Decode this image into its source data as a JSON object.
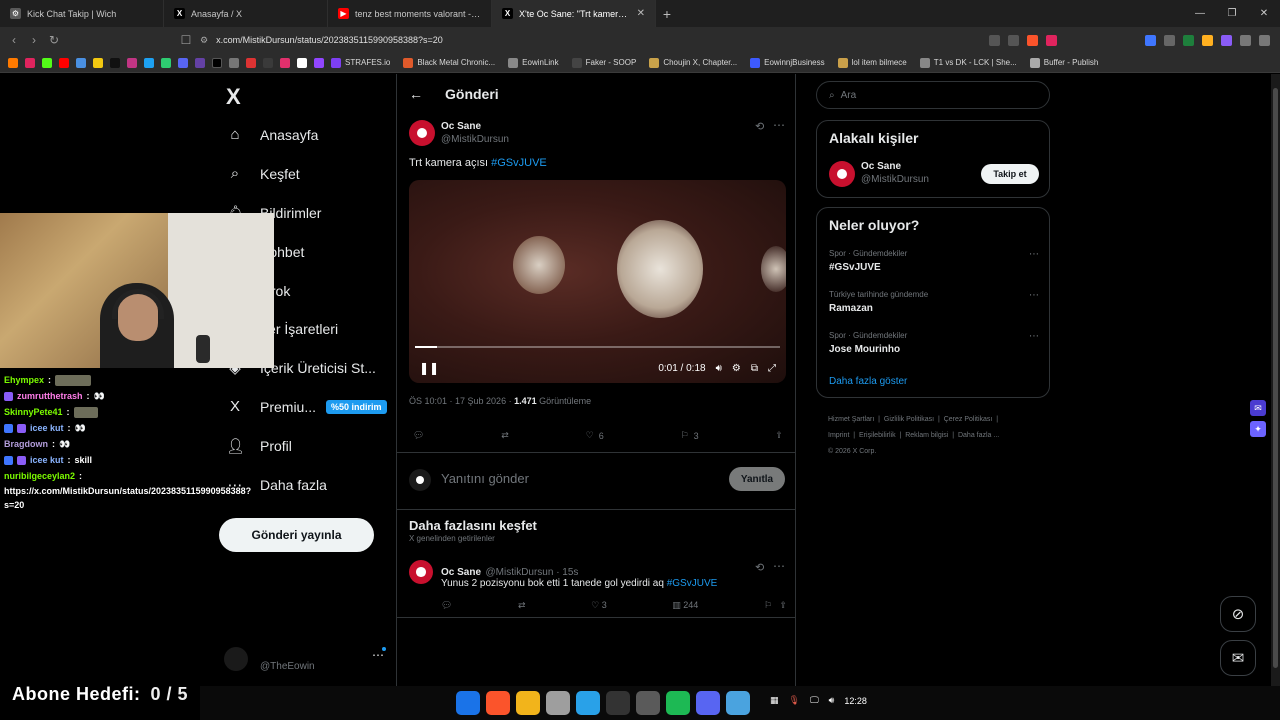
{
  "browser": {
    "tabs": [
      {
        "title": "Kick Chat Takip | Wich",
        "color": "#5a5a5a",
        "glyph": "⚙"
      },
      {
        "title": "Anasayfa / X",
        "color": "#000000",
        "glyph": "X"
      },
      {
        "title": "tenz best moments valorant - YouTub",
        "color": "#ff0000",
        "glyph": "▶"
      },
      {
        "title": "X'te Oc Sane: \"Trt kamera açı",
        "color": "#000000",
        "glyph": "X"
      }
    ],
    "active_tab_index": 3,
    "new_tab": "+",
    "url": "x.com/MistikDursun/status/2023835115990958388?s=20",
    "bookmarks": [
      {
        "label": "STRAFES.io",
        "color": "#7e3ff2"
      },
      {
        "label": "Black Metal Chronic...",
        "color": "#e05a2b"
      },
      {
        "label": "EowinLink",
        "color": "#888888"
      },
      {
        "label": "Faker - SOOP",
        "color": "#444444"
      },
      {
        "label": "Choujin X, Chapter...",
        "color": "#c9a24a"
      },
      {
        "label": "EowinnjBusiness",
        "color": "#3d5afe"
      },
      {
        "label": "lol item bilmece",
        "color": "#caa04a"
      },
      {
        "label": "T1 vs DK - LCK | She...",
        "color": "#888888"
      },
      {
        "label": "Buffer - Publish",
        "color": "#aaaaaa"
      }
    ]
  },
  "sidebar": {
    "logo": "X",
    "items": [
      {
        "label": "Anasayfa",
        "icon": "home-icon"
      },
      {
        "label": "Keşfet",
        "icon": "search-icon"
      },
      {
        "label": "Bildirimler",
        "icon": "bell-icon"
      },
      {
        "label": "Sohbet",
        "icon": "chat-icon"
      },
      {
        "label": "Grok",
        "icon": "grok-icon"
      },
      {
        "label": "Yer İşaretleri",
        "icon": "bookmark-icon"
      },
      {
        "label": "İçerik Üreticisi St...",
        "icon": "creator-icon"
      },
      {
        "label": "Premiu...",
        "icon": "premium-icon"
      },
      {
        "label": "Profil",
        "icon": "profile-icon"
      },
      {
        "label": "Daha fazla",
        "icon": "more-icon"
      }
    ],
    "premium_badge": "%50 indirim",
    "post_button": "Gönderi yayınla",
    "account_handle": "@TheEowin"
  },
  "post": {
    "header_title": "Gönderi",
    "author_name": "Oc Sane",
    "author_handle": "@MistikDursun",
    "text": "Trt kamera açısı ",
    "hashtag": "#GSvJUVE",
    "video_time": "0:01 / 0:18",
    "video_progress": 0.06,
    "timestamp": "ÖS 10:01 · 17 Şub 2026 · ",
    "views": "1.471",
    "views_label": " Görüntüleme",
    "likes": "6",
    "bookmarks": "3",
    "reply_placeholder": "Yanıtını gönder",
    "reply_button": "Yanıtla"
  },
  "discover": {
    "title": "Daha fazlasını keşfet",
    "subtitle": "X genelinden getirilenler",
    "tweet": {
      "author_name": "Oc Sane",
      "author_handle": "@MistikDursun · 15s",
      "text": "Yunus 2 pozisyonu bok etti 1 tanede gol yedirdi aq ",
      "hashtag": "#GSvJUVE",
      "likes": "3",
      "views": "244"
    }
  },
  "right": {
    "search_placeholder": "Ara",
    "relevant_title": "Alakalı kişiler",
    "relevant_name": "Oc Sane",
    "relevant_handle": "@MistikDursun",
    "follow_button": "Takip et",
    "trends_title": "Neler oluyor?",
    "trends": [
      {
        "category": "Spor · Gündemdekiler",
        "name": "#GSvJUVE"
      },
      {
        "category": "Türkiye tarihinde gündemde",
        "name": "Ramazan"
      },
      {
        "category": "Spor · Gündemdekiler",
        "name": "Jose Mourinho"
      }
    ],
    "show_more": "Daha fazla göster",
    "footer": [
      "Hizmet Şartları",
      "Gizlilik Politikası",
      "Çerez Politikası",
      "Imprint",
      "Erişilebilirlik",
      "Reklam bilgisi",
      "Daha fazla ...",
      "© 2026 X Corp."
    ]
  },
  "stream_chat": [
    {
      "user": "Ehympex",
      "color": "#7cfc00",
      "text": "",
      "emote": true
    },
    {
      "user": "zumrutthetrash",
      "color": "#ff7de9",
      "text": "👀",
      "badge": "#8a5cf6"
    },
    {
      "user": "SkinnyPete41",
      "color": "#7cfc00",
      "text": "",
      "emote": true
    },
    {
      "user": "icee kut",
      "color": "#8ab4ff",
      "text": "👀",
      "badge": "#3f76ff"
    },
    {
      "user": "Bragdown",
      "color": "#b39ddb",
      "text": "👀"
    },
    {
      "user": "icee kut",
      "color": "#8ab4ff",
      "text": "skill",
      "badge": "#3f76ff"
    },
    {
      "user": "nuribilgeceylan2",
      "color": "#7cfc00",
      "text": ""
    }
  ],
  "chat_url": "https://x.com/MistikDursun/status/2023835115990958388?s=20",
  "sub_goal_label": "Abone Hedefi:",
  "sub_goal_count": "0 / 5",
  "clock": "12:28",
  "taskbar_icons": [
    "#1a73e8",
    "#fb542b",
    "#f2b41b",
    "#9e9e9e",
    "#29a1e8",
    "#333333",
    "#5a5a5a",
    "#1db954",
    "#5865f2",
    "#4aa3df"
  ]
}
